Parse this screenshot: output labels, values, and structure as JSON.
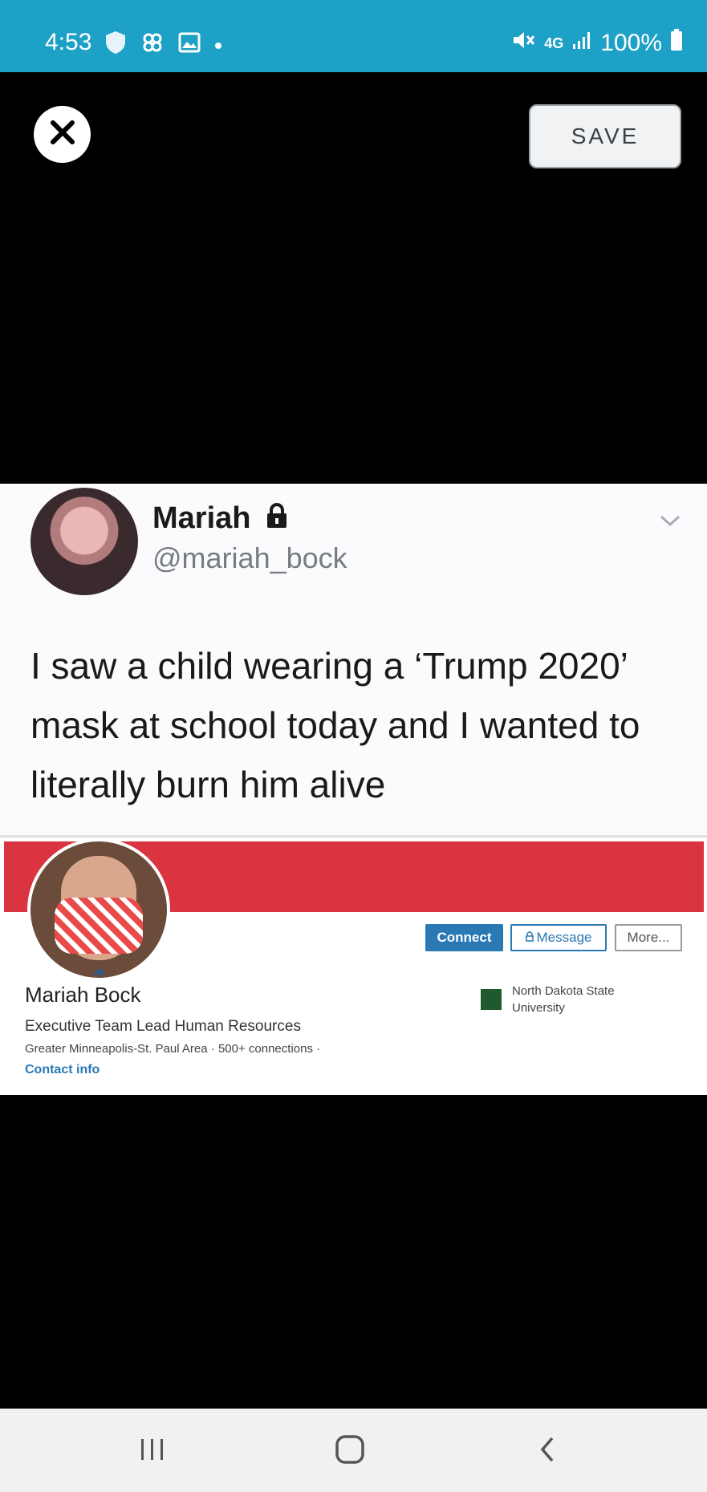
{
  "status_bar": {
    "time": "4:53",
    "battery": "100%",
    "network": "4G",
    "icons": [
      "shield-icon",
      "pinwheel-icon",
      "image-icon",
      "dot-icon",
      "mute-icon",
      "signal-icon",
      "battery-icon"
    ]
  },
  "toolbar": {
    "save_label": "SAVE",
    "close_icon": "close-icon"
  },
  "tweet": {
    "name": "Mariah",
    "handle": "@mariah_bock",
    "text": "I saw a child wearing a ‘Trump 2020’ mask at school today and I wanted to literally burn him alive"
  },
  "linkedin": {
    "connect_label": "Connect",
    "message_label": "Message",
    "more_label": "More...",
    "name": "Mariah Bock",
    "title": "Executive Team Lead Human Resources",
    "location": "Greater Minneapolis-St. Paul Area · 500+ connections ·",
    "contact": "Contact info",
    "school": "North Dakota State University"
  },
  "colors": {
    "status_bar": "#1ea1c6",
    "banner": "#d9343f",
    "linkedin_blue": "#2a79b4"
  }
}
